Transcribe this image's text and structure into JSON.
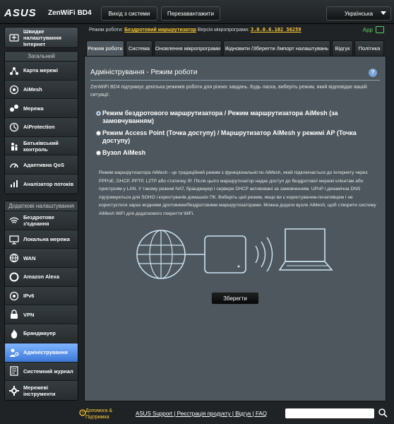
{
  "header": {
    "brand": "ASUS",
    "model": "ZenWiFi BD4",
    "logout_label": "Вихід з системи",
    "reboot_label": "Перезавантажити",
    "language": "Українська"
  },
  "info": {
    "mode_prefix": "Режим роботи:",
    "mode_value": "Бездротовий маршрутизатор",
    "fw_prefix": "Версія мікропрограми:",
    "fw_value": "3.0.0.6.102_56259",
    "app_label": "App"
  },
  "sidebar": {
    "quick_label": "Швидке налаштування Інтернет",
    "general_header": "Загальний",
    "general_items": [
      {
        "label": "Карта мережі",
        "icon": "network-map-icon"
      },
      {
        "label": "AiMesh",
        "icon": "aimesh-icon"
      },
      {
        "label": "Мережа",
        "icon": "network-icon"
      },
      {
        "label": "AiProtection",
        "icon": "aiprotection-icon"
      },
      {
        "label": "Батьківський контроль",
        "icon": "parental-control-icon"
      },
      {
        "label": "Адаптивна QoS",
        "icon": "qos-icon"
      },
      {
        "label": "Аналізатор потоків",
        "icon": "traffic-analyzer-icon"
      }
    ],
    "advanced_header": "Додаткові налаштування",
    "advanced_items": [
      {
        "label": "Бездротове з'єднання",
        "icon": "wireless-icon"
      },
      {
        "label": "Локальна мережа",
        "icon": "lan-icon"
      },
      {
        "label": "WAN",
        "icon": "wan-icon"
      },
      {
        "label": "Amazon Alexa",
        "icon": "alexa-icon"
      },
      {
        "label": "IPv6",
        "icon": "ipv6-icon"
      },
      {
        "label": "VPN",
        "icon": "vpn-icon"
      },
      {
        "label": "Брандмауер",
        "icon": "firewall-icon"
      },
      {
        "label": "Адміністрування",
        "icon": "administration-icon"
      },
      {
        "label": "Системний журнал",
        "icon": "system-log-icon"
      },
      {
        "label": "Мережеві інструменти",
        "icon": "network-tools-icon"
      }
    ],
    "active_item": "Адміністрування"
  },
  "tabs": [
    {
      "label": "Режим роботи"
    },
    {
      "label": "Система"
    },
    {
      "label": "Оновлення мікропрограми"
    },
    {
      "label": "Відновити /Зберегти /Імпорт налаштувань"
    },
    {
      "label": "Відгук"
    },
    {
      "label": "Політика"
    }
  ],
  "main": {
    "title": "Адміністрування - Режим роботи",
    "intro": "ZenWiFi BD4 підтримує декілька режимів роботи для різних завдань. Будь ласка, виберіть режим, який відповідає вашій ситуації.",
    "options": [
      {
        "label": "Режим бездротового маршрутизатора / Режим маршрутизатора AiMesh (за замовчуванням)",
        "selected": true
      },
      {
        "label": "Режим Access Point (Точка доступу) / Маршрутизатор AiMesh у режимі AP (Точка доступу)",
        "selected": false
      },
      {
        "label": "Вузол AiMesh",
        "selected": false
      }
    ],
    "description": "Режим маршрутизатора AiMesh - це традиційний режим з функціональністю AiMesh, який підключається до Інтернету через PPPoE, DHCP, PPTP, L2TP або статичну IP. Після цього маршрутизатор надає доступ до бездротової мережі клієнтам або пристроям у LAN. У такому режимі NAT, брандмауер і сервери DHCP активовані за замовченням. UPnP і динамічна DNS підтримуються для SOHO і користувачів домашніх ПК. Виберіть цей режим, якщо ви є користувачем-початківцем і не користуєтеся зараз жодними дротовими/бездротовими маршрутизаторами. Можна додати вузли AiMesh, щоб створити систему AiMesh WiFi для додаткового покриття WiFi.",
    "save_label": "Зберегти"
  },
  "footer": {
    "help_label": "Допомога & Підтримка",
    "links": [
      "ASUS Support",
      "Реєстрація продукту",
      "Відгук",
      "FAQ"
    ]
  },
  "colors": {
    "accent": "#3b78d8",
    "link_yellow": "#ffcc33",
    "panel": "#4d575d"
  }
}
